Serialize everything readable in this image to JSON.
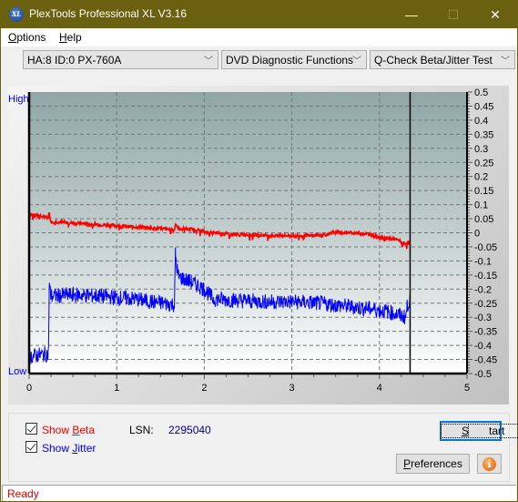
{
  "window": {
    "title": "PlexTools Professional XL V3.16",
    "icon_text": "XL",
    "minimize": "—",
    "maximize": "☐",
    "close": "✕"
  },
  "menu": {
    "items": [
      {
        "label": "Options",
        "mnemonic": "O",
        "rest": "ptions"
      },
      {
        "label": "Help",
        "mnemonic": "H",
        "rest": "elp"
      }
    ]
  },
  "toolbar": {
    "drive_select": "HA:8 ID:0  PX-760A",
    "function_select": "DVD Diagnostic Functions",
    "test_select": "Q-Check Beta/Jitter Test",
    "chevron": "﹀"
  },
  "controls": {
    "show_beta": {
      "label_pre": "Show ",
      "mnemonic": "B",
      "label_post": "eta",
      "checked": true,
      "color": "#ff0000"
    },
    "show_jitter": {
      "label_pre": "Show ",
      "mnemonic": "J",
      "label_post": "itter",
      "checked": true,
      "color": "#0000ff"
    },
    "lsn_label": "LSN:",
    "lsn_value": "2295040",
    "start_button": {
      "mnemonic": "S",
      "rest": "tart"
    },
    "preferences_button": {
      "mnemonic": "P",
      "rest": "references"
    },
    "info_button": "i"
  },
  "status": {
    "text": "Ready"
  },
  "chart_data": {
    "type": "line",
    "title": "",
    "xlabel": "",
    "ylabel_left_top": "High",
    "ylabel_left_bottom": "Low",
    "xlim": [
      0,
      5
    ],
    "ylim": [
      -0.5,
      0.5
    ],
    "x_ticks": [
      0,
      1,
      2,
      3,
      4,
      5
    ],
    "y_ticks": [
      0.5,
      0.45,
      0.4,
      0.35,
      0.3,
      0.25,
      0.2,
      0.15,
      0.1,
      0.05,
      0,
      -0.05,
      -0.1,
      -0.15,
      -0.2,
      -0.25,
      -0.3,
      -0.35,
      -0.4,
      -0.45,
      -0.5
    ],
    "y_tick_labels": [
      "0.5",
      "0.45",
      "0.4",
      "0.35",
      "0.3",
      "0.25",
      "0.2",
      "0.15",
      "0.1",
      "0.05",
      "0",
      "-0.05",
      "-0.1",
      "-0.15",
      "-0.2",
      "-0.25",
      "-0.3",
      "-0.35",
      "-0.4",
      "-0.45",
      "-0.5"
    ],
    "grid": true,
    "marker_x": 4.35,
    "series": [
      {
        "name": "Beta",
        "color": "#ff0000",
        "x": [
          0,
          0.1,
          0.22,
          0.23,
          0.25,
          0.5,
          0.75,
          1.0,
          1.25,
          1.5,
          1.66,
          1.67,
          1.7,
          1.9,
          2.05,
          2.3,
          2.6,
          2.8,
          3.0,
          3.2,
          3.45,
          3.47,
          3.7,
          3.9,
          4.0,
          4.2,
          4.3,
          4.33,
          4.35
        ],
        "y": [
          0.065,
          0.06,
          0.055,
          0.07,
          0.04,
          0.035,
          0.03,
          0.025,
          0.02,
          0.015,
          0.01,
          0.035,
          0.015,
          0.012,
          0.0,
          -0.005,
          -0.008,
          -0.01,
          -0.01,
          -0.01,
          -0.005,
          0.002,
          0.0,
          -0.005,
          -0.015,
          -0.025,
          -0.04,
          -0.035,
          -0.04
        ]
      },
      {
        "name": "Jitter",
        "color": "#0000ff",
        "x": [
          0,
          0.1,
          0.22,
          0.23,
          0.25,
          0.5,
          0.8,
          1.0,
          1.2,
          1.4,
          1.66,
          1.67,
          1.7,
          1.85,
          2.0,
          2.1,
          2.4,
          2.7,
          3.0,
          3.3,
          3.6,
          3.9,
          4.1,
          4.3,
          4.32,
          4.35
        ],
        "y": [
          -0.44,
          -0.435,
          -0.43,
          -0.19,
          -0.225,
          -0.22,
          -0.225,
          -0.23,
          -0.235,
          -0.245,
          -0.255,
          -0.075,
          -0.155,
          -0.175,
          -0.2,
          -0.235,
          -0.24,
          -0.245,
          -0.245,
          -0.25,
          -0.26,
          -0.27,
          -0.28,
          -0.3,
          -0.255,
          -0.24
        ]
      }
    ]
  }
}
